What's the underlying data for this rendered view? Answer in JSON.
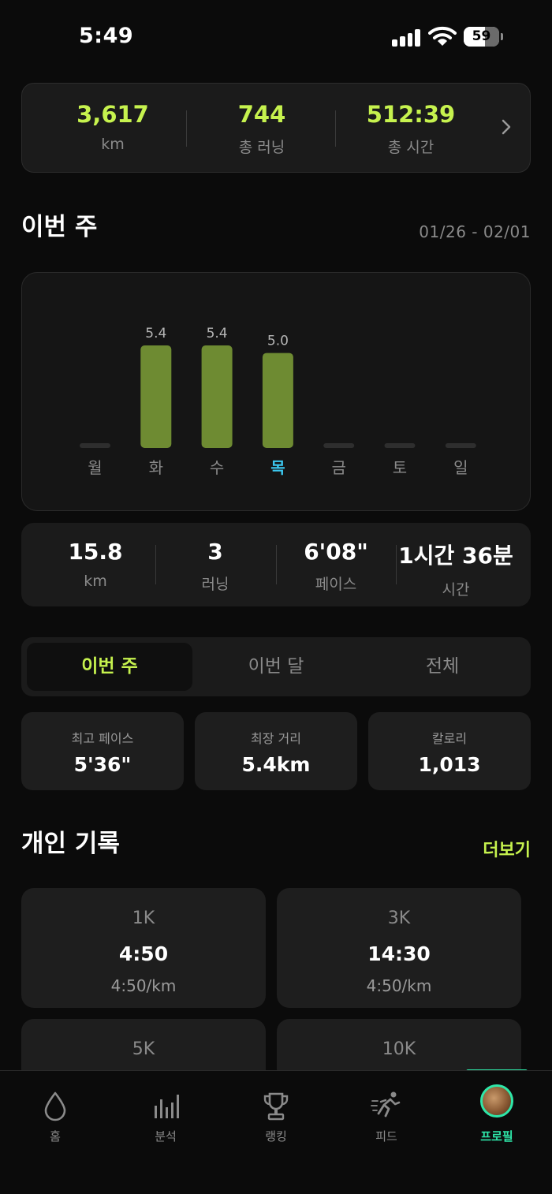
{
  "status_bar": {
    "time": "5:49",
    "battery": "59",
    "battery_level": 0.59
  },
  "totals": [
    {
      "value": "3,617",
      "label": "km"
    },
    {
      "value": "744",
      "label": "총 러닝"
    },
    {
      "value": "512:39",
      "label": "총 시간"
    }
  ],
  "this_week": {
    "title": "이번 주",
    "date_range": "01/26 - 02/01"
  },
  "chart_data": {
    "type": "bar",
    "categories": [
      "월",
      "화",
      "수",
      "목",
      "금",
      "토",
      "일"
    ],
    "values": [
      0,
      5.4,
      5.4,
      5.0,
      0,
      0,
      0
    ],
    "value_labels": [
      "",
      "5.4",
      "5.4",
      "5.0",
      "",
      "",
      ""
    ],
    "highlight_category": "목",
    "ylim": [
      0,
      5.4
    ],
    "grid": false,
    "colors": {
      "bar": "#6e8b32",
      "empty_bar": "#2e2e2e",
      "label": "#8a8a8a",
      "highlight_label": "#3cc8f0"
    }
  },
  "week_stats": [
    {
      "value": "15.8",
      "label": "km"
    },
    {
      "value": "3",
      "label": "러닝"
    },
    {
      "value": "6'08\"",
      "label": "페이스"
    },
    {
      "value": "1시간 36분",
      "label": "시간"
    }
  ],
  "segments": [
    {
      "label": "이번 주",
      "active": true
    },
    {
      "label": "이번 달",
      "active": false
    },
    {
      "label": "전체",
      "active": false
    }
  ],
  "highlights": [
    {
      "label": "최고 페이스",
      "value": "5'36\""
    },
    {
      "label": "최장 거리",
      "value": "5.4km"
    },
    {
      "label": "칼로리",
      "value": "1,013"
    }
  ],
  "records": {
    "title": "개인 기록",
    "more": "더보기",
    "items": [
      {
        "distance": "1K",
        "time": "4:50",
        "pace": "4:50/km"
      },
      {
        "distance": "3K",
        "time": "14:30",
        "pace": "4:50/km"
      },
      {
        "distance": "5K",
        "time": "",
        "pace": ""
      },
      {
        "distance": "10K",
        "time": "",
        "pace": ""
      }
    ]
  },
  "tabbar": [
    {
      "label": "홈",
      "icon": "drop-icon"
    },
    {
      "label": "분석",
      "icon": "bar-chart-icon"
    },
    {
      "label": "랭킹",
      "icon": "trophy-icon"
    },
    {
      "label": "피드",
      "icon": "runner-icon"
    },
    {
      "label": "프로필",
      "icon": "avatar",
      "active": true
    }
  ],
  "colors": {
    "accent": "#c6f24e",
    "active_tab": "#2ee6a8",
    "background": "#0b0b0b",
    "card": "#1b1b1b"
  }
}
